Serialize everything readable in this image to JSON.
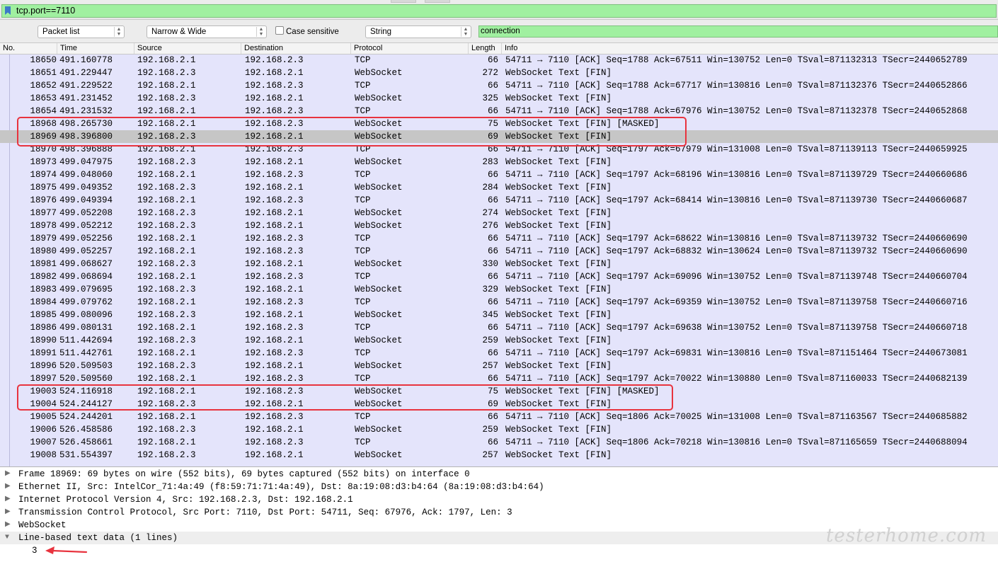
{
  "display_filter": {
    "value": "tcp.port==7110"
  },
  "search_bar": {
    "search_in": "Packet list",
    "char_width": "Narrow & Wide",
    "case_sensitive_label": "Case sensitive",
    "search_type": "String",
    "search_value": "connection"
  },
  "columns": [
    "No.",
    "Time",
    "Source",
    "Destination",
    "Protocol",
    "Length",
    "Info"
  ],
  "packets": [
    {
      "no": "18650",
      "time": "491.160778",
      "src": "192.168.2.1",
      "dst": "192.168.2.3",
      "proto": "TCP",
      "len": "66",
      "info": "54711 → 7110 [ACK] Seq=1788 Ack=67511 Win=130752 Len=0 TSval=871132313 TSecr=2440652789"
    },
    {
      "no": "18651",
      "time": "491.229447",
      "src": "192.168.2.3",
      "dst": "192.168.2.1",
      "proto": "WebSocket",
      "len": "272",
      "info": "WebSocket Text [FIN]"
    },
    {
      "no": "18652",
      "time": "491.229522",
      "src": "192.168.2.1",
      "dst": "192.168.2.3",
      "proto": "TCP",
      "len": "66",
      "info": "54711 → 7110 [ACK] Seq=1788 Ack=67717 Win=130816 Len=0 TSval=871132376 TSecr=2440652866"
    },
    {
      "no": "18653",
      "time": "491.231452",
      "src": "192.168.2.3",
      "dst": "192.168.2.1",
      "proto": "WebSocket",
      "len": "325",
      "info": "WebSocket Text [FIN]"
    },
    {
      "no": "18654",
      "time": "491.231532",
      "src": "192.168.2.1",
      "dst": "192.168.2.3",
      "proto": "TCP",
      "len": "66",
      "info": "54711 → 7110 [ACK] Seq=1788 Ack=67976 Win=130752 Len=0 TSval=871132378 TSecr=2440652868"
    },
    {
      "no": "18968",
      "time": "498.265730",
      "src": "192.168.2.1",
      "dst": "192.168.2.3",
      "proto": "WebSocket",
      "len": "75",
      "info": "WebSocket Text [FIN] [MASKED]"
    },
    {
      "no": "18969",
      "time": "498.396800",
      "src": "192.168.2.3",
      "dst": "192.168.2.1",
      "proto": "WebSocket",
      "len": "69",
      "info": "WebSocket Text [FIN]"
    },
    {
      "no": "18970",
      "time": "498.396888",
      "src": "192.168.2.1",
      "dst": "192.168.2.3",
      "proto": "TCP",
      "len": "66",
      "info": "54711 → 7110 [ACK] Seq=1797 Ack=67979 Win=131008 Len=0 TSval=871139113 TSecr=2440659925"
    },
    {
      "no": "18973",
      "time": "499.047975",
      "src": "192.168.2.3",
      "dst": "192.168.2.1",
      "proto": "WebSocket",
      "len": "283",
      "info": "WebSocket Text [FIN]"
    },
    {
      "no": "18974",
      "time": "499.048060",
      "src": "192.168.2.1",
      "dst": "192.168.2.3",
      "proto": "TCP",
      "len": "66",
      "info": "54711 → 7110 [ACK] Seq=1797 Ack=68196 Win=130816 Len=0 TSval=871139729 TSecr=2440660686"
    },
    {
      "no": "18975",
      "time": "499.049352",
      "src": "192.168.2.3",
      "dst": "192.168.2.1",
      "proto": "WebSocket",
      "len": "284",
      "info": "WebSocket Text [FIN]"
    },
    {
      "no": "18976",
      "time": "499.049394",
      "src": "192.168.2.1",
      "dst": "192.168.2.3",
      "proto": "TCP",
      "len": "66",
      "info": "54711 → 7110 [ACK] Seq=1797 Ack=68414 Win=130816 Len=0 TSval=871139730 TSecr=2440660687"
    },
    {
      "no": "18977",
      "time": "499.052208",
      "src": "192.168.2.3",
      "dst": "192.168.2.1",
      "proto": "WebSocket",
      "len": "274",
      "info": "WebSocket Text [FIN]"
    },
    {
      "no": "18978",
      "time": "499.052212",
      "src": "192.168.2.3",
      "dst": "192.168.2.1",
      "proto": "WebSocket",
      "len": "276",
      "info": "WebSocket Text [FIN]"
    },
    {
      "no": "18979",
      "time": "499.052256",
      "src": "192.168.2.1",
      "dst": "192.168.2.3",
      "proto": "TCP",
      "len": "66",
      "info": "54711 → 7110 [ACK] Seq=1797 Ack=68622 Win=130816 Len=0 TSval=871139732 TSecr=2440660690"
    },
    {
      "no": "18980",
      "time": "499.052257",
      "src": "192.168.2.1",
      "dst": "192.168.2.3",
      "proto": "TCP",
      "len": "66",
      "info": "54711 → 7110 [ACK] Seq=1797 Ack=68832 Win=130624 Len=0 TSval=871139732 TSecr=2440660690"
    },
    {
      "no": "18981",
      "time": "499.068627",
      "src": "192.168.2.3",
      "dst": "192.168.2.1",
      "proto": "WebSocket",
      "len": "330",
      "info": "WebSocket Text [FIN]"
    },
    {
      "no": "18982",
      "time": "499.068694",
      "src": "192.168.2.1",
      "dst": "192.168.2.3",
      "proto": "TCP",
      "len": "66",
      "info": "54711 → 7110 [ACK] Seq=1797 Ack=69096 Win=130752 Len=0 TSval=871139748 TSecr=2440660704"
    },
    {
      "no": "18983",
      "time": "499.079695",
      "src": "192.168.2.3",
      "dst": "192.168.2.1",
      "proto": "WebSocket",
      "len": "329",
      "info": "WebSocket Text [FIN]"
    },
    {
      "no": "18984",
      "time": "499.079762",
      "src": "192.168.2.1",
      "dst": "192.168.2.3",
      "proto": "TCP",
      "len": "66",
      "info": "54711 → 7110 [ACK] Seq=1797 Ack=69359 Win=130752 Len=0 TSval=871139758 TSecr=2440660716"
    },
    {
      "no": "18985",
      "time": "499.080096",
      "src": "192.168.2.3",
      "dst": "192.168.2.1",
      "proto": "WebSocket",
      "len": "345",
      "info": "WebSocket Text [FIN]"
    },
    {
      "no": "18986",
      "time": "499.080131",
      "src": "192.168.2.1",
      "dst": "192.168.2.3",
      "proto": "TCP",
      "len": "66",
      "info": "54711 → 7110 [ACK] Seq=1797 Ack=69638 Win=130752 Len=0 TSval=871139758 TSecr=2440660718"
    },
    {
      "no": "18990",
      "time": "511.442694",
      "src": "192.168.2.3",
      "dst": "192.168.2.1",
      "proto": "WebSocket",
      "len": "259",
      "info": "WebSocket Text [FIN]"
    },
    {
      "no": "18991",
      "time": "511.442761",
      "src": "192.168.2.1",
      "dst": "192.168.2.3",
      "proto": "TCP",
      "len": "66",
      "info": "54711 → 7110 [ACK] Seq=1797 Ack=69831 Win=130816 Len=0 TSval=871151464 TSecr=2440673081"
    },
    {
      "no": "18996",
      "time": "520.509503",
      "src": "192.168.2.3",
      "dst": "192.168.2.1",
      "proto": "WebSocket",
      "len": "257",
      "info": "WebSocket Text [FIN]"
    },
    {
      "no": "18997",
      "time": "520.509560",
      "src": "192.168.2.1",
      "dst": "192.168.2.3",
      "proto": "TCP",
      "len": "66",
      "info": "54711 → 7110 [ACK] Seq=1797 Ack=70022 Win=130880 Len=0 TSval=871160033 TSecr=2440682139"
    },
    {
      "no": "19003",
      "time": "524.116918",
      "src": "192.168.2.1",
      "dst": "192.168.2.3",
      "proto": "WebSocket",
      "len": "75",
      "info": "WebSocket Text [FIN] [MASKED]"
    },
    {
      "no": "19004",
      "time": "524.244127",
      "src": "192.168.2.3",
      "dst": "192.168.2.1",
      "proto": "WebSocket",
      "len": "69",
      "info": "WebSocket Text [FIN]"
    },
    {
      "no": "19005",
      "time": "524.244201",
      "src": "192.168.2.1",
      "dst": "192.168.2.3",
      "proto": "TCP",
      "len": "66",
      "info": "54711 → 7110 [ACK] Seq=1806 Ack=70025 Win=131008 Len=0 TSval=871163567 TSecr=2440685882"
    },
    {
      "no": "19006",
      "time": "526.458586",
      "src": "192.168.2.3",
      "dst": "192.168.2.1",
      "proto": "WebSocket",
      "len": "259",
      "info": "WebSocket Text [FIN]"
    },
    {
      "no": "19007",
      "time": "526.458661",
      "src": "192.168.2.1",
      "dst": "192.168.2.3",
      "proto": "TCP",
      "len": "66",
      "info": "54711 → 7110 [ACK] Seq=1806 Ack=70218 Win=130816 Len=0 TSval=871165659 TSecr=2440688094"
    },
    {
      "no": "19008",
      "time": "531.554397",
      "src": "192.168.2.3",
      "dst": "192.168.2.1",
      "proto": "WebSocket",
      "len": "257",
      "info": "WebSocket Text [FIN]"
    }
  ],
  "selected_packet": "18969",
  "detail_tree": [
    {
      "label": "Frame 18969: 69 bytes on wire (552 bits), 69 bytes captured (552 bits) on interface 0",
      "expanded": false
    },
    {
      "label": "Ethernet II, Src: IntelCor_71:4a:49 (f8:59:71:71:4a:49), Dst: 8a:19:08:d3:b4:64 (8a:19:08:d3:b4:64)",
      "expanded": false
    },
    {
      "label": "Internet Protocol Version 4, Src: 192.168.2.3, Dst: 192.168.2.1",
      "expanded": false
    },
    {
      "label": "Transmission Control Protocol, Src Port: 7110, Dst Port: 54711, Seq: 67976, Ack: 1797, Len: 3",
      "expanded": false
    },
    {
      "label": "WebSocket",
      "expanded": false
    },
    {
      "label": "Line-based text data (1 lines)",
      "expanded": true
    }
  ],
  "detail_child": "3",
  "watermark": "testerhome.com",
  "colors": {
    "filter_valid": "#a0f0a0",
    "row_background": "#e4e4fb",
    "row_selected": "#c6c6c6",
    "annotation": "#e8333e"
  }
}
